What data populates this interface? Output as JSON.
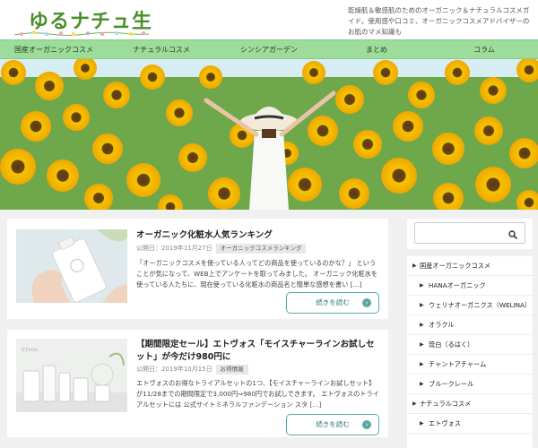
{
  "site": {
    "logo_text": "ゆるナチュ生活",
    "tagline": "乾燥肌＆敏感肌のためのオーガニック＆ナチュラルコスメガイド。使用感や口コミ、オーガニックコスメアドバイザーのお肌のマメ知識も"
  },
  "nav": {
    "items": [
      {
        "label": "国産オーガニックコスメ"
      },
      {
        "label": "ナチュラルコスメ"
      },
      {
        "label": "シンシアガーデン"
      },
      {
        "label": "まとめ"
      },
      {
        "label": "コラム"
      }
    ]
  },
  "posts": [
    {
      "title": "オーガニック化粧水人気ランキング",
      "date": "公開日：2019年11月27日",
      "category": "オーガニックコスメランキング",
      "excerpt": "「オーガニックコスメを使っている人ってどの商品を使っているのかな？」 ということが気になって、WEB上でアンケートを取ってみました。 オーガニック化粧水を使っている人たちに、現在使っている化粧水の商品名と簡単な感想を書い […]",
      "more_label": "続きを読む"
    },
    {
      "title": "【期間限定セール】エトヴォス「モイスチャーラインお試しセット」が今だけ980円に",
      "date": "公開日：2019年10月15日",
      "category": "お得情報",
      "excerpt": "エトヴォスのお得なトライアルセットの1つ、【モイスチャーラインお試しセット】が11/28までの期間限定で3,000円⇒980円でお試しできます。 エトヴォスのトライアルセットには 公式サイトミネラルファンデーション スタ […]",
      "more_label": "続きを読む"
    }
  ],
  "sidebar": {
    "items": [
      {
        "label": "国産オーガニックコスメ",
        "level": 0
      },
      {
        "label": "HANAオーガニック",
        "level": 1
      },
      {
        "label": "ウェリナオーガニクス（WELINA）",
        "level": 1
      },
      {
        "label": "オラクル",
        "level": 1
      },
      {
        "label": "琉白（るはく）",
        "level": 1
      },
      {
        "label": "チャントアチャーム",
        "level": 1
      },
      {
        "label": "ブルークレール",
        "level": 1
      },
      {
        "label": "ナチュラルコスメ",
        "level": 0
      },
      {
        "label": "エトヴォス",
        "level": 1
      }
    ]
  },
  "colors": {
    "nav_bg": "#9ddc9a",
    "logo": "#4a8f2a",
    "button_border": "#5aa8a4"
  }
}
